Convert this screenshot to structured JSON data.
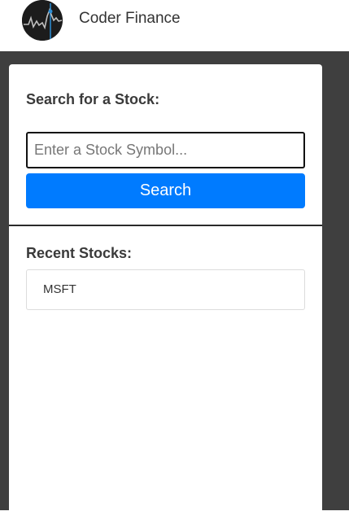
{
  "navbar": {
    "brand": "Coder Finance",
    "logo_icon": "stock-chart-logo-icon"
  },
  "search": {
    "heading": "Search for a Stock:",
    "input_value": "",
    "placeholder": "Enter a Stock Symbol...",
    "button_label": "Search",
    "button_color": "#007bff"
  },
  "recent": {
    "heading": "Recent Stocks:",
    "items": [
      {
        "symbol": "MSFT"
      }
    ]
  },
  "colors": {
    "background": "#3f3f3f",
    "card": "#ffffff",
    "logo_background": "#1c1c1c",
    "logo_accent": "#2d8fd6"
  }
}
